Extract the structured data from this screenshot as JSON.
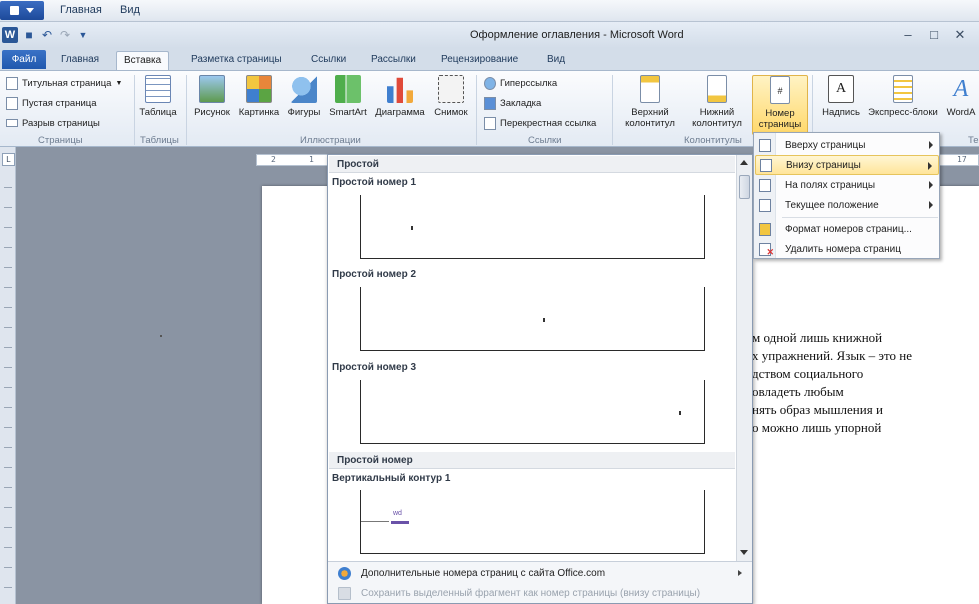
{
  "host_menu": {
    "items": [
      "Главная",
      "Вид"
    ]
  },
  "window": {
    "title": "Оформление оглавления - Microsoft Word",
    "word_letter": "W",
    "qat_icons": [
      "save-icon",
      "undo-icon",
      "redo-icon",
      "customize-icon"
    ]
  },
  "tabs": {
    "file": "Файл",
    "items": [
      "Главная",
      "Вставка",
      "Разметка страницы",
      "Ссылки",
      "Рассылки",
      "Рецензирование",
      "Вид"
    ],
    "active": "Вставка"
  },
  "ribbon": {
    "pages": {
      "label": "Страницы",
      "cover": "Титульная страница",
      "blank": "Пустая страница",
      "break": "Разрыв страницы"
    },
    "tables": {
      "label": "Таблицы",
      "table": "Таблица"
    },
    "illustrations": {
      "label": "Иллюстрации",
      "picture": "Рисунок",
      "clipart": "Картинка",
      "shapes": "Фигуры",
      "smartart": "SmartArt",
      "chart": "Диаграмма",
      "screenshot": "Снимок"
    },
    "links": {
      "label": "Ссылки",
      "hyperlink": "Гиперссылка",
      "bookmark": "Закладка",
      "crossref": "Перекрестная ссылка"
    },
    "header_footer": {
      "label": "Колонтитулы",
      "header_l1": "Верхний",
      "header_l2": "колонтитул",
      "footer_l1": "Нижний",
      "footer_l2": "колонтитул",
      "pagenum_l1": "Номер",
      "pagenum_l2": "страницы"
    },
    "text": {
      "label": "Те",
      "textbox": "Надпись",
      "quickparts": "Экспресс-блоки",
      "wordart": "WordA"
    }
  },
  "ruler": {
    "numbers": [
      "2",
      "1",
      "17"
    ]
  },
  "gallery": {
    "section1": "Простой",
    "items": [
      {
        "title": "Простой номер 1",
        "num_pos": "left"
      },
      {
        "title": "Простой номер 2",
        "num_pos": "center"
      },
      {
        "title": "Простой номер 3",
        "num_pos": "right"
      }
    ],
    "section2": "Простой номер",
    "item4": {
      "title": "Вертикальный контур 1",
      "label": "wd"
    },
    "footer": {
      "more": "Дополнительные номера страниц с сайта Office.com",
      "save": "Сохранить выделенный фрагмент как номер страницы (внизу страницы)"
    }
  },
  "menu": {
    "items": [
      {
        "label": "Вверху страницы",
        "submenu": true
      },
      {
        "label": "Внизу страницы",
        "submenu": true,
        "highlighted": true
      },
      {
        "label": "На полях страницы",
        "submenu": true
      },
      {
        "label": "Текущее положение",
        "submenu": true
      },
      {
        "label": "Формат номеров страниц...",
        "submenu": false
      },
      {
        "label": "Удалить номера страниц",
        "submenu": false
      }
    ]
  },
  "document": {
    "lines": [
      "м одной лишь книжной",
      "х упражнений. Язык – это не",
      "дством социального",
      "овладеть любым",
      "нять образ мышления и",
      "о можно лишь упорной"
    ]
  },
  "colors": {
    "accent": "#2b5797",
    "highlight": "#ffe59a",
    "ribbon_bg": "#e3eaf3"
  }
}
